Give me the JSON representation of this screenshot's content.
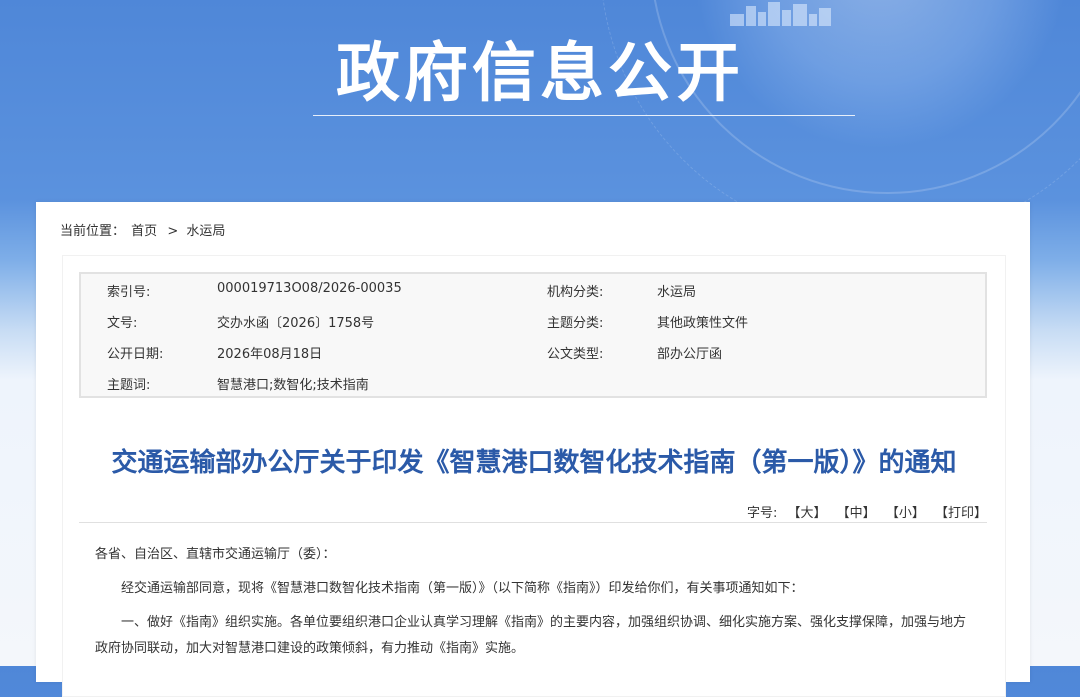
{
  "header": {
    "title": "政府信息公开"
  },
  "breadcrumb": {
    "label": "当前位置：",
    "home": "首页",
    "sep": ">",
    "current": "水运局"
  },
  "meta": {
    "index_label": "索引号:",
    "index_value": "000019713O08/2026-00035",
    "org_label": "机构分类:",
    "org_value": "水运局",
    "docno_label": "文号:",
    "docno_value": "交办水函〔2026〕1758号",
    "topic_label": "主题分类:",
    "topic_value": "其他政策性文件",
    "date_label": "公开日期:",
    "date_value": "2026年08月18日",
    "type_label": "公文类型:",
    "type_value": "部办公厅函",
    "keywords_label": "主题词:",
    "keywords_value": "智慧港口;数智化;技术指南"
  },
  "document": {
    "title": "交通运输部办公厅关于印发《智慧港口数智化技术指南（第一版）》的通知",
    "font_label": "字号:",
    "btn_large": "【大】",
    "btn_medium": "【中】",
    "btn_small": "【小】",
    "btn_print": "【打印】",
    "salutation": "各省、自治区、直辖市交通运输厅（委）：",
    "para1": "经交通运输部同意，现将《智慧港口数智化技术指南（第一版）》（以下简称《指南》）印发给你们，有关事项通知如下：",
    "para2": "一、做好《指南》组织实施。各单位要组织港口企业认真学习理解《指南》的主要内容，加强组织协调、细化实施方案、强化支撑保障，加强与地方政府协同联动，加大对智慧港口建设的政策倾斜，有力推动《指南》实施。"
  },
  "colors": {
    "banner": "#4f87d8",
    "title_blue": "#2b5aa8"
  }
}
